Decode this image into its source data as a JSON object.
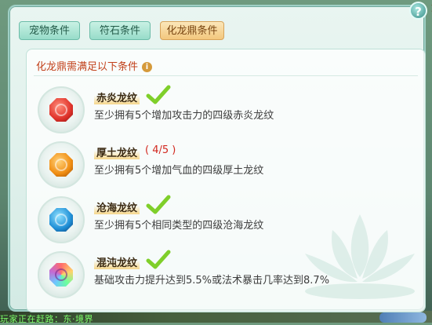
{
  "window": {
    "help_label": "?",
    "close_label": "×"
  },
  "tabs": [
    {
      "label": "宠物条件",
      "active": false
    },
    {
      "label": "符石条件",
      "active": false
    },
    {
      "label": "化龙鼎条件",
      "active": true
    }
  ],
  "panel": {
    "title": "化龙鼎需满足以下条件",
    "info_icon": "i"
  },
  "conditions": [
    {
      "name": "赤炎龙纹",
      "status": "done",
      "progress": "",
      "description": "至少拥有5个增加攻击力的四级赤炎龙纹",
      "gem_color": "#e0332b",
      "icon": "red-dragon-gem-icon"
    },
    {
      "name": "厚土龙纹",
      "status": "in-progress",
      "progress": "( 4/5 )",
      "description": "至少拥有5个增加气血的四级厚土龙纹",
      "gem_color": "#f08d12",
      "icon": "orange-dragon-gem-icon"
    },
    {
      "name": "沧海龙纹",
      "status": "done",
      "progress": "",
      "description": "至少拥有5个相同类型的四级沧海龙纹",
      "gem_color": "#1f8fd6",
      "icon": "blue-dragon-gem-icon"
    },
    {
      "name": "混沌龙纹",
      "status": "done",
      "progress": "",
      "description": "基础攻击力提升达到5.5%或法术暴击几率达到8.7%",
      "gem_color": "#c46bd3",
      "icon": "rainbow-dragon-gem-icon"
    }
  ],
  "background": {
    "chat_text": "玩家正在赶路：东·境界"
  },
  "colors": {
    "check": "#7fcf2a",
    "title": "#c2411b",
    "progress": "#d2281f"
  }
}
